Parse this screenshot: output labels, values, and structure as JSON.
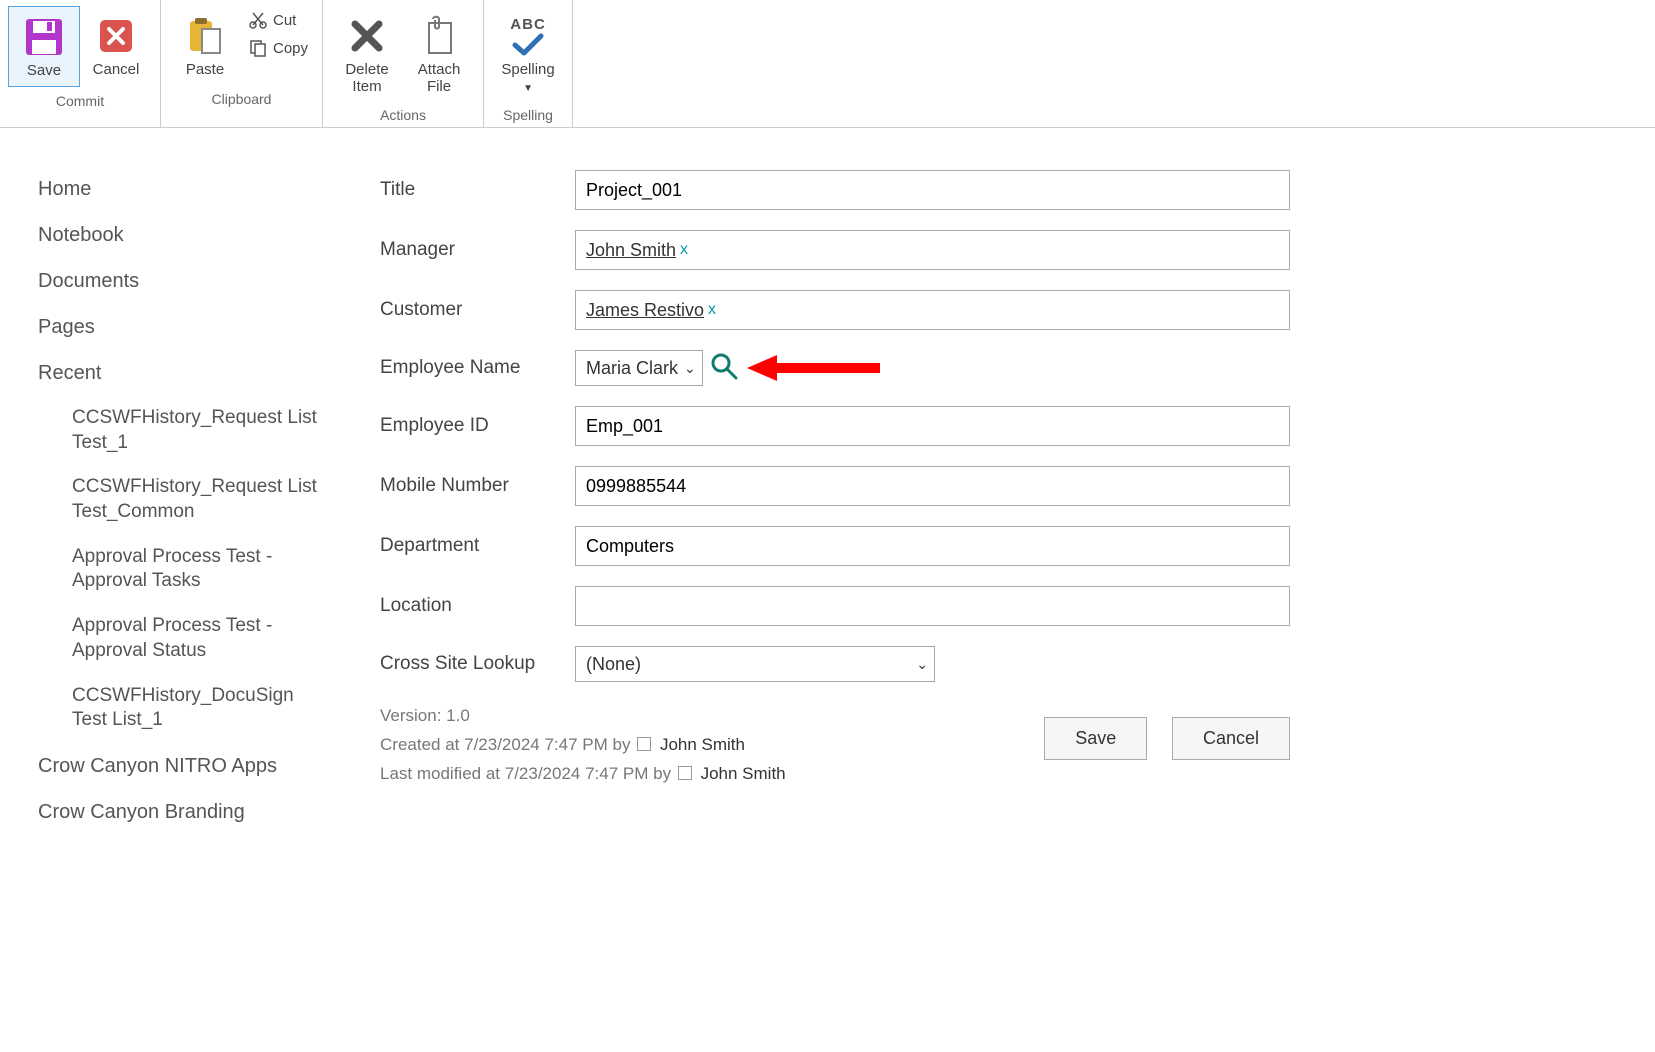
{
  "ribbon": {
    "save": "Save",
    "cancel": "Cancel",
    "paste": "Paste",
    "cut": "Cut",
    "copy": "Copy",
    "delete_item": "Delete\nItem",
    "attach_file": "Attach\nFile",
    "spelling": "Spelling",
    "groups": {
      "commit": "Commit",
      "clipboard": "Clipboard",
      "actions": "Actions",
      "spelling": "Spelling"
    }
  },
  "sidebar": {
    "home": "Home",
    "notebook": "Notebook",
    "documents": "Documents",
    "pages": "Pages",
    "recent": "Recent",
    "recent_items": [
      "CCSWFHistory_Request List Test_1",
      "CCSWFHistory_Request List Test_Common",
      "Approval Process Test - Approval Tasks",
      "Approval Process Test - Approval Status",
      "CCSWFHistory_DocuSign Test List_1"
    ],
    "nitro_apps": "Crow Canyon NITRO Apps",
    "branding": "Crow Canyon Branding"
  },
  "form": {
    "labels": {
      "title": "Title",
      "manager": "Manager",
      "customer": "Customer",
      "employee_name": "Employee Name",
      "employee_id": "Employee ID",
      "mobile_number": "Mobile Number",
      "department": "Department",
      "location": "Location",
      "cross_site": "Cross Site Lookup"
    },
    "values": {
      "title": "Project_001",
      "manager": "John Smith",
      "customer": "James Restivo",
      "employee_name": "Maria Clark",
      "employee_id": "Emp_001",
      "mobile_number": "0999885544",
      "department": "Computers",
      "location": "",
      "cross_site": "(None)"
    }
  },
  "meta": {
    "version_label": "Version: ",
    "version": "1.0",
    "created_prefix": "Created at ",
    "created_at": "7/23/2024 7:47 PM",
    "by": "  by",
    "created_by": "John Smith",
    "modified_prefix": "Last modified at ",
    "modified_at": "7/23/2024 7:47 PM",
    "modified_by": "John Smith"
  },
  "buttons": {
    "save": "Save",
    "cancel": "Cancel"
  }
}
